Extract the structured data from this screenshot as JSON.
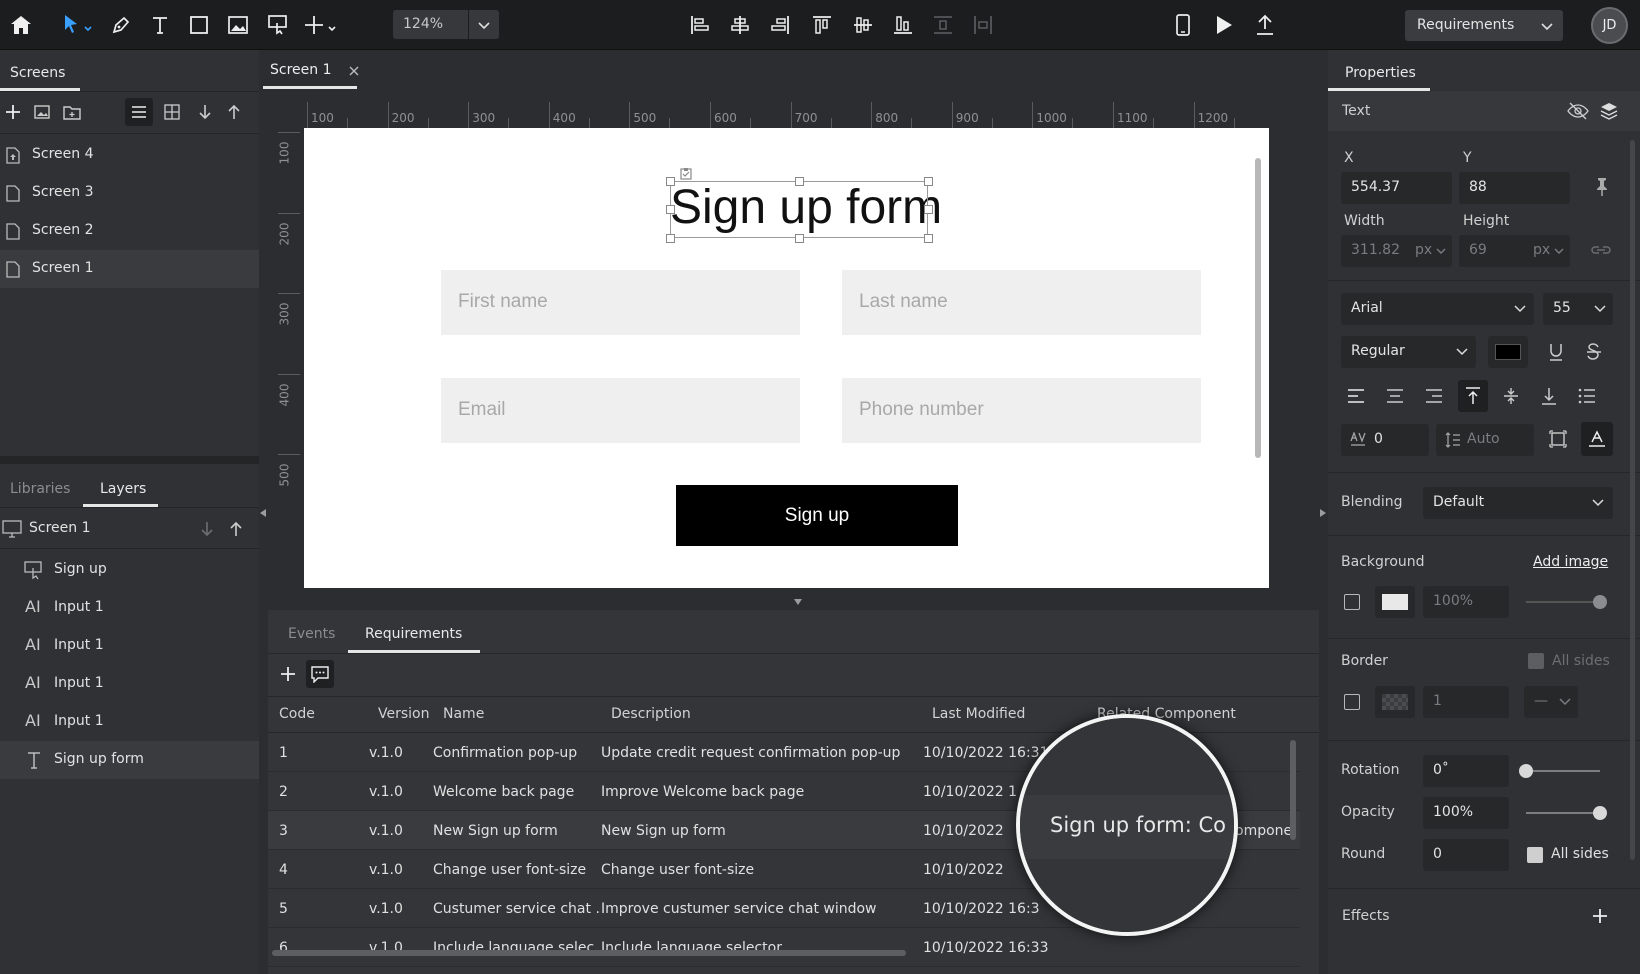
{
  "topbar": {
    "zoom": "124%",
    "requirements_select": "Requirements",
    "avatar_initials": "JD"
  },
  "left": {
    "screens_tab": "Screens",
    "screens": [
      "Screen 4",
      "Screen 3",
      "Screen 2",
      "Screen 1"
    ],
    "tabs": [
      "Libraries",
      "Layers"
    ],
    "layers_root": "Screen 1",
    "layers": [
      {
        "icon": "button-icon",
        "label": "Sign up"
      },
      {
        "icon": "input-icon",
        "label": "Input 1"
      },
      {
        "icon": "input-icon",
        "label": "Input 1"
      },
      {
        "icon": "input-icon",
        "label": "Input 1"
      },
      {
        "icon": "input-icon",
        "label": "Input 1"
      },
      {
        "icon": "text-icon",
        "label": "Sign up form"
      }
    ]
  },
  "doc_tab": "Screen 1",
  "ruler": {
    "h": [
      "100",
      "200",
      "300",
      "400",
      "500",
      "600",
      "700",
      "800",
      "900",
      "1000",
      "1100",
      "1200"
    ],
    "v": [
      "100",
      "200",
      "300",
      "400",
      "500"
    ]
  },
  "canvas": {
    "title": "Sign up form",
    "first_name": "First name",
    "last_name": "Last name",
    "email": "Email",
    "phone": "Phone number",
    "button": "Sign up"
  },
  "bottom": {
    "tabs": [
      "Events",
      "Requirements"
    ],
    "columns": [
      "Code",
      "Version",
      "Name",
      "Description",
      "Last Modified",
      "Related Component"
    ],
    "rows": [
      {
        "code": "1",
        "version": "v.1.0",
        "name": "Confirmation pop-up",
        "desc": "Update credit request confirmation pop-up",
        "modified": "10/10/2022 16:31"
      },
      {
        "code": "2",
        "version": "v.1.0",
        "name": "Welcome back page",
        "desc": "Improve Welcome back page",
        "modified": "10/10/2022 1"
      },
      {
        "code": "3",
        "version": "v.1.0",
        "name": "New Sign up form",
        "desc": "New Sign up form",
        "modified": "10/10/2022",
        "related": "ompone"
      },
      {
        "code": "4",
        "version": "v.1.0",
        "name": "Change user font-size",
        "desc": "Change user font-size",
        "modified": "10/10/2022"
      },
      {
        "code": "5",
        "version": "v.1.0",
        "name": "Custumer service chat ...",
        "desc": "Improve custumer service chat window",
        "modified": "10/10/2022 16:3"
      },
      {
        "code": "6",
        "version": "v.1.0",
        "name": "Include language selec...",
        "desc": "Include language selector",
        "modified": "10/10/2022 16:33"
      }
    ],
    "magnifier_text": "Sign up form: Co"
  },
  "props": {
    "tab": "Properties",
    "section": "Text",
    "x_label": "X",
    "y_label": "Y",
    "x": "554.37",
    "y": "88",
    "width_label": "Width",
    "height_label": "Height",
    "width": "311.82",
    "height": "69",
    "unit": "px",
    "font": "Arial",
    "font_size": "55",
    "weight": "Regular",
    "letter_spacing": "0",
    "line_height": "Auto",
    "blending_label": "Blending",
    "blending": "Default",
    "background_label": "Background",
    "add_image": "Add image",
    "bg_opacity": "100%",
    "border_label": "Border",
    "all_sides": "All sides",
    "border_width": "1",
    "border_style": "—",
    "rotation_label": "Rotation",
    "rotation": "0˚",
    "opacity_label": "Opacity",
    "opacity": "100%",
    "round_label": "Round",
    "round": "0",
    "effects_label": "Effects"
  }
}
